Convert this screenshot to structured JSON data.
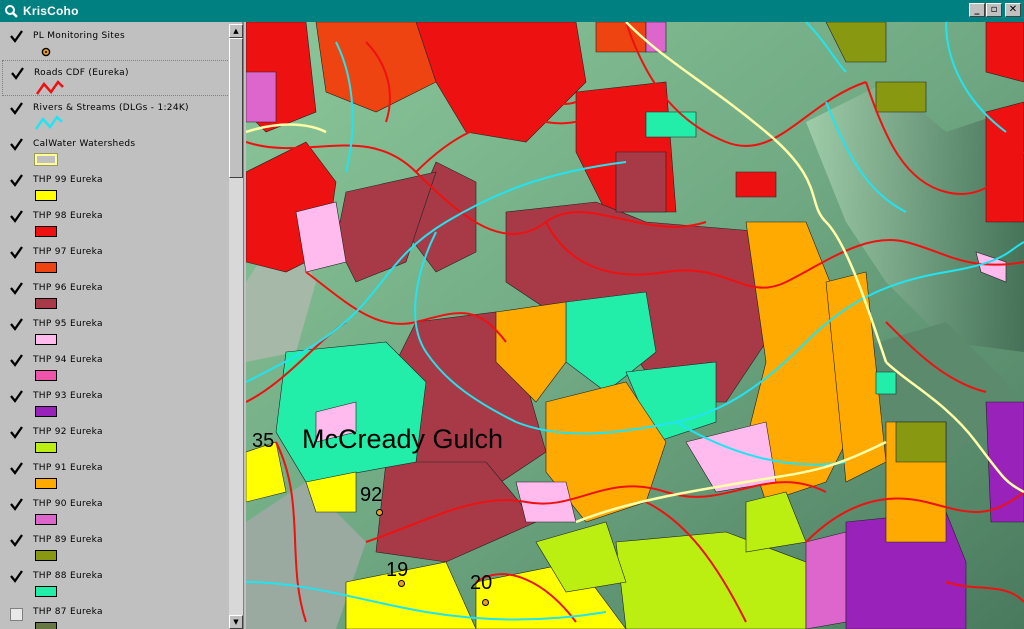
{
  "window": {
    "title": "KrisCoho",
    "controls": {
      "minimize": "_",
      "maximize": "▫",
      "close": "✕"
    }
  },
  "legend": {
    "layers": [
      {
        "name": "PL Monitoring Sites",
        "checked": true,
        "symbol": "point-icon"
      },
      {
        "name": "Roads CDF (Eureka)",
        "checked": true,
        "symbol": "red-line-icon"
      },
      {
        "name": "Rivers & Streams (DLGs - 1:24K)",
        "checked": true,
        "symbol": "cyan-line-icon"
      },
      {
        "name": "CalWater Watersheds",
        "checked": true,
        "symbol": "outline-box",
        "color": "#ffff99"
      },
      {
        "name": "THP 99 Eureka",
        "checked": true,
        "color": "#ffff00"
      },
      {
        "name": "THP 98 Eureka",
        "checked": true,
        "color": "#ee1111"
      },
      {
        "name": "THP 97 Eureka",
        "checked": true,
        "color": "#ee4411"
      },
      {
        "name": "THP 96 Eureka",
        "checked": true,
        "color": "#a83a48"
      },
      {
        "name": "THP 95 Eureka",
        "checked": true,
        "color": "#ffbbee"
      },
      {
        "name": "THP 94 Eureka",
        "checked": true,
        "color": "#ee55aa"
      },
      {
        "name": "THP 93 Eureka",
        "checked": true,
        "color": "#9922bb"
      },
      {
        "name": "THP 92 Eureka",
        "checked": true,
        "color": "#bbee11"
      },
      {
        "name": "THP 91 Eureka",
        "checked": true,
        "color": "#ffaa00"
      },
      {
        "name": "THP 90 Eureka",
        "checked": true,
        "color": "#dd66cc"
      },
      {
        "name": "THP 89 Eureka",
        "checked": true,
        "color": "#889911"
      },
      {
        "name": "THP 88 Eureka",
        "checked": true,
        "color": "#22eeaa"
      },
      {
        "name": "THP 87 Eureka",
        "checked": false,
        "color": "#667744"
      }
    ]
  },
  "scrollbar": {
    "up": "▲",
    "down": "▼"
  },
  "map": {
    "watershed_label": "McCready Gulch",
    "site_labels": [
      "35",
      "92",
      "19",
      "20"
    ]
  }
}
